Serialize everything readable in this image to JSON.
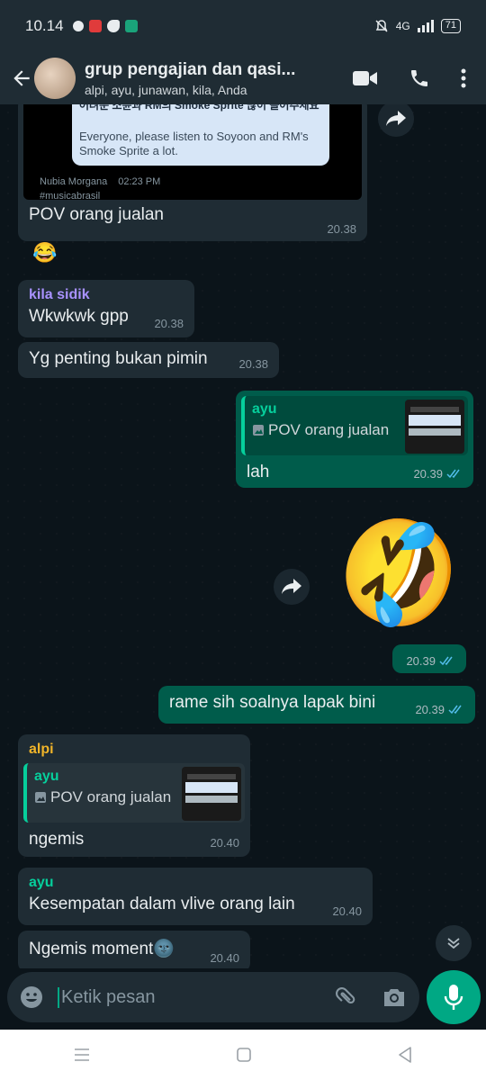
{
  "status_bar": {
    "time": "10.14",
    "network": "4G",
    "battery": "71"
  },
  "header": {
    "title": "grup pengajian dan qasi...",
    "subtitle": "alpi, ayu, junawan, kila, Anda"
  },
  "messages": {
    "m0": {
      "embed_text_korean": "어려운 소윤과 RM의 Smoke Sprite 많이 들어주세요",
      "embed_text_en": "Everyone, please listen to Soyoon and RM's Smoke Sprite a lot.",
      "embed_author": "Nubia Morgana",
      "embed_time": "02:23 PM",
      "embed_tag": "#musicabrasil",
      "text": "POV orang jualan",
      "emoji": "😂",
      "time": "20.38"
    },
    "m1": {
      "sender": "kila sidik",
      "sender_color": "#a992ff",
      "text": "Wkwkwk gpp",
      "time": "20.38"
    },
    "m2": {
      "text": "Yg penting bukan pimin",
      "time": "20.38"
    },
    "m3": {
      "quote_name": "ayu",
      "quote_text": "POV orang jualan",
      "text": "lah",
      "time": "20.39"
    },
    "m4": {
      "sticker": "🤣",
      "time": "20.39"
    },
    "m5": {
      "text": "rame sih soalnya lapak bini",
      "time": "20.39"
    },
    "m6": {
      "sender": "alpi",
      "sender_color": "#f0b429",
      "quote_name": "ayu",
      "quote_text": "POV orang jualan",
      "text": "ngemis",
      "time": "20.40"
    },
    "m7": {
      "sender": "ayu",
      "sender_color": "#06cf9c",
      "text": "Kesempatan dalam vlive orang lain",
      "time": "20.40"
    },
    "m8": {
      "text": "Ngemis moment🌚",
      "time": "20.40"
    }
  },
  "input": {
    "placeholder": "Ketik pesan"
  },
  "colors": {
    "accent": "#00a884",
    "outgoing": "#005c4b",
    "incoming": "#1f2c34",
    "background": "#0b141a",
    "read_ticks": "#53bdeb"
  }
}
